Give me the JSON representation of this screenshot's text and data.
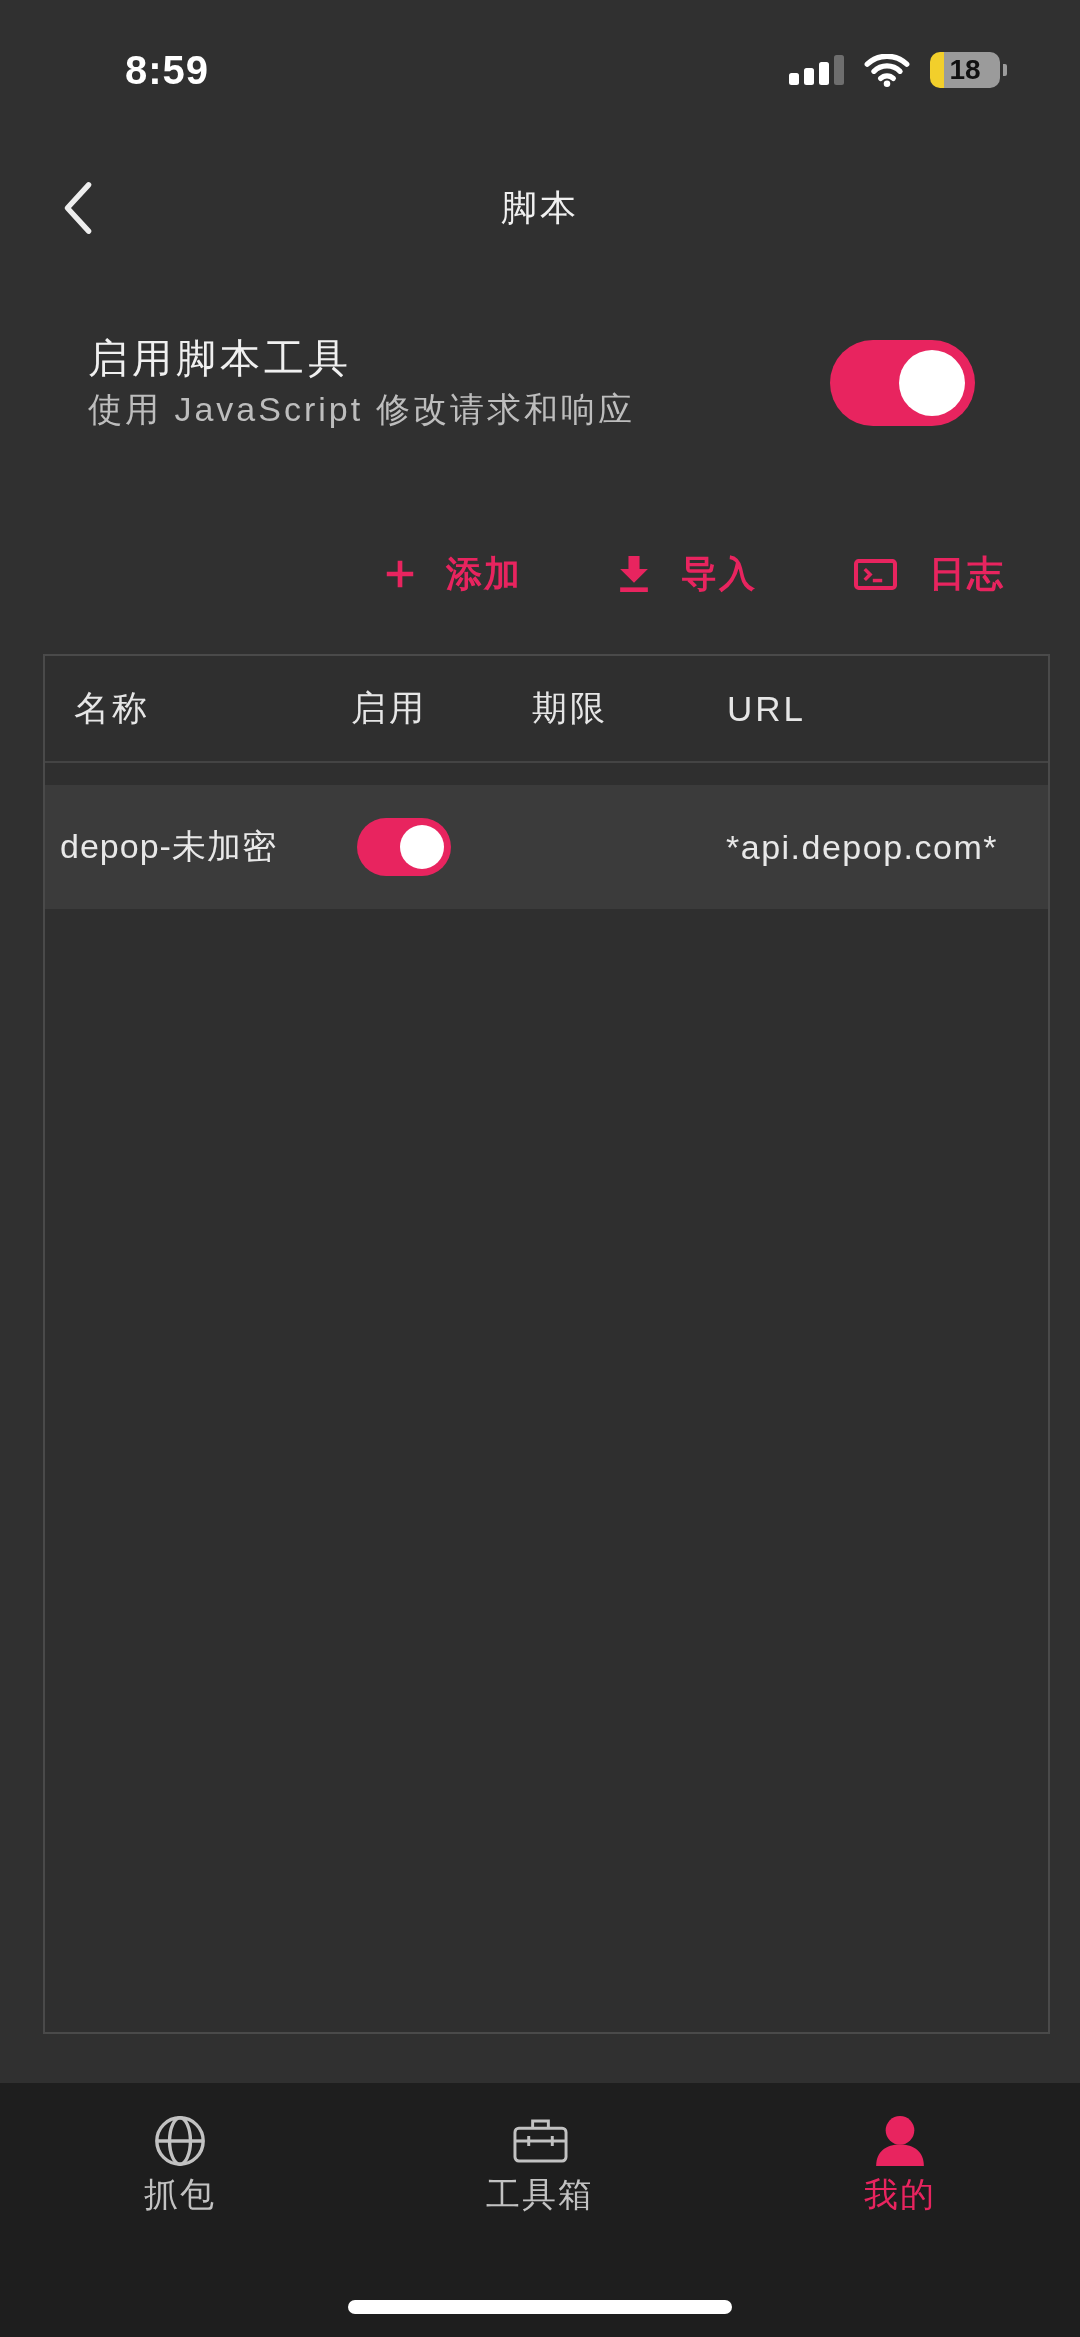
{
  "status_bar": {
    "time": "8:59",
    "battery": "18"
  },
  "header": {
    "title": "脚本"
  },
  "script_toggle": {
    "title": "启用脚本工具",
    "subtitle": "使用 JavaScript 修改请求和响应",
    "on": true
  },
  "toolbar": [
    {
      "kind": "add",
      "label": "添加"
    },
    {
      "kind": "import",
      "label": "导入"
    },
    {
      "kind": "log",
      "label": "日志"
    }
  ],
  "table": {
    "columns": [
      "名称",
      "启用",
      "期限",
      "URL"
    ],
    "rows": [
      {
        "name": "depop-未加密",
        "enabled": true,
        "url": "*api.depop.com*"
      }
    ]
  },
  "bottom_nav": [
    {
      "kind": "globe",
      "label": "抓包",
      "selected": false
    },
    {
      "kind": "toolbox",
      "label": "工具箱",
      "selected": false
    },
    {
      "kind": "person",
      "label": "我的",
      "selected": true
    }
  ]
}
